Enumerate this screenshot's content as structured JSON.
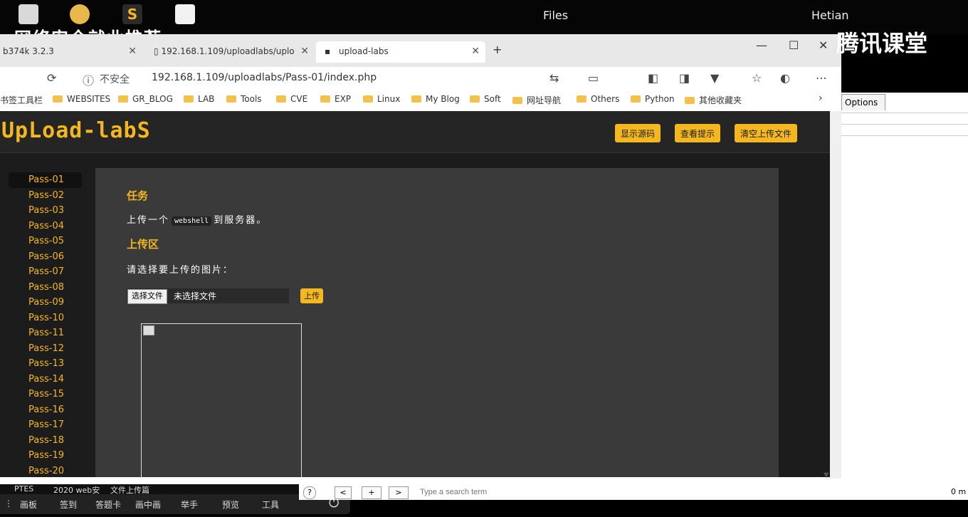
{
  "desktop": {
    "title_center": "Files",
    "title_right": "Hetian",
    "overlay_text": "网络安全就业推荐",
    "watermark": "腾讯课堂"
  },
  "browser": {
    "tabs": [
      {
        "label": "b374k 3.2.3"
      },
      {
        "label": "192.168.1.109/uploadlabs/uplo"
      },
      {
        "label": "upload-labs"
      }
    ],
    "new_tab": "+",
    "insecure_label": "不安全",
    "url": "192.168.1.109/uploadlabs/Pass-01/index.php",
    "bookmarks": [
      "书签工具栏",
      "WEBSITES",
      "GR_BLOG",
      "LAB",
      "Tools",
      "CVE",
      "EXP",
      "Linux",
      "My Blog",
      "Soft",
      "网址导航",
      "Others",
      "Python",
      "其他收藏夹"
    ]
  },
  "page": {
    "logo": "UpLoad-labS",
    "header_buttons": [
      "显示源码",
      "查看提示",
      "清空上传文件"
    ],
    "sidebar": [
      "Pass-01",
      "Pass-02",
      "Pass-03",
      "Pass-04",
      "Pass-05",
      "Pass-06",
      "Pass-07",
      "Pass-08",
      "Pass-09",
      "Pass-10",
      "Pass-11",
      "Pass-12",
      "Pass-13",
      "Pass-14",
      "Pass-15",
      "Pass-16",
      "Pass-17",
      "Pass-18",
      "Pass-19",
      "Pass-20"
    ],
    "task_heading": "任务",
    "task_desc_before": "上传一个",
    "task_code": "webshell",
    "task_desc_after": "到服务器。",
    "upload_heading": "上传区",
    "prompt": "请选择要上传的图片：",
    "choose_file": "选择文件",
    "no_file": "未选择文件",
    "upload_button": "上传"
  },
  "right_app": {
    "options_tab": "Options",
    "partial_text": "0 m"
  },
  "taskbar": {
    "line1": [
      "PTES",
      "2020 web安",
      "文件上传篇"
    ],
    "items": [
      "画板",
      "签到",
      "答题卡",
      "画中画",
      "举手",
      "预览",
      "工具"
    ]
  },
  "burp_bar": {
    "help": "?",
    "prev": "<",
    "add": "+",
    "next": ">",
    "search_placeholder": "Type a search term"
  }
}
